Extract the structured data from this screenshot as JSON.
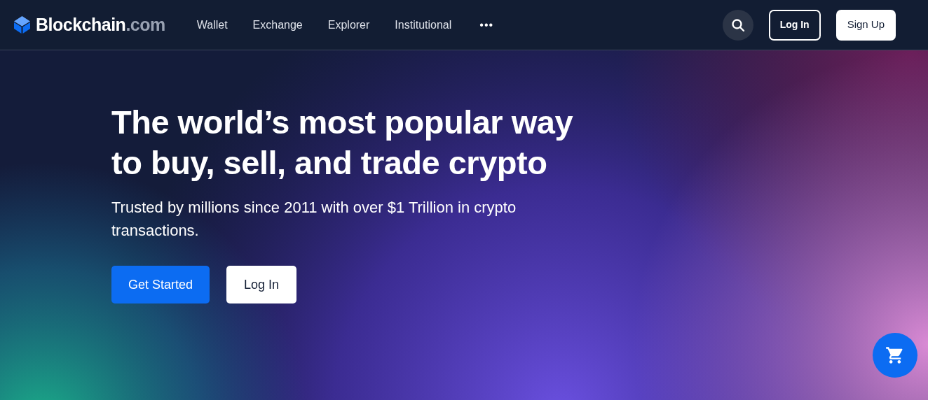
{
  "header": {
    "brand": {
      "name": "Blockchain",
      "suffix": ".com"
    },
    "nav": [
      {
        "label": "Wallet"
      },
      {
        "label": "Exchange"
      },
      {
        "label": "Explorer"
      },
      {
        "label": "Institutional"
      }
    ],
    "more": "•••",
    "login": "Log In",
    "signup": "Sign Up"
  },
  "hero": {
    "title": "The world’s most popular way to buy, sell, and trade crypto",
    "subtitle": "Trusted by millions since 2011 with over $1 Trillion in crypto transactions.",
    "buttons": [
      {
        "label": "Get Started",
        "kind": "primary"
      },
      {
        "label": "Log In",
        "kind": "secondary"
      }
    ]
  }
}
